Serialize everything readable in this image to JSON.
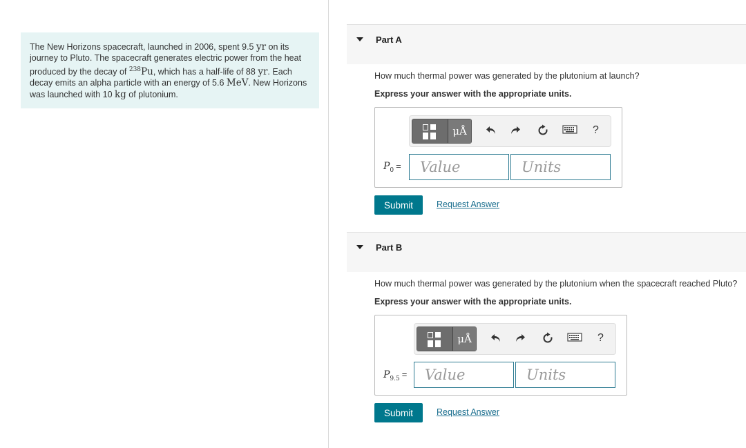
{
  "problem": {
    "t1": "The New Horizons spacecraft, launched in 2006, spent 9.5 ",
    "u_yr": "yr",
    "t2": " on its journey to Pluto. The spacecraft generates electric power from the heat produced by the decay of ",
    "iso_mass": "238",
    "iso_sym": "Pu",
    "t3": ", which has a half-life of 88 ",
    "t4": ". Each decay emits an alpha particle with an energy of 5.6 ",
    "u_mev": "MeV",
    "t5": ". New Horizons was launched with 10 ",
    "u_kg": "kg",
    "t6": " of plutonium."
  },
  "parts": [
    {
      "title": "Part A",
      "question": "How much thermal power was generated by the plutonium at launch?",
      "instruction": "Express your answer with the appropriate units.",
      "var_symbol": "P",
      "var_sub": "0",
      "equals": "=",
      "value_placeholder": "Value",
      "units_placeholder": "Units",
      "submit_label": "Submit",
      "request_label": "Request Answer"
    },
    {
      "title": "Part B",
      "question": "How much thermal power was generated by the plutonium when the spacecraft reached Pluto?",
      "instruction": "Express your answer with the appropriate units.",
      "var_symbol": "P",
      "var_sub": "9.5",
      "equals": "=",
      "value_placeholder": "Value",
      "units_placeholder": "Units",
      "submit_label": "Submit",
      "request_label": "Request Answer"
    }
  ],
  "toolbar": {
    "units_button": "μÅ",
    "help": "?",
    "icons": [
      "templates-icon",
      "units-icon",
      "undo-icon",
      "redo-icon",
      "reset-icon",
      "keyboard-icon",
      "help-icon"
    ]
  },
  "colors": {
    "problem_bg": "#e6f4f4",
    "submit_bg": "#00788d",
    "link": "#1a6e8e",
    "field_border": "#2b7a91"
  }
}
